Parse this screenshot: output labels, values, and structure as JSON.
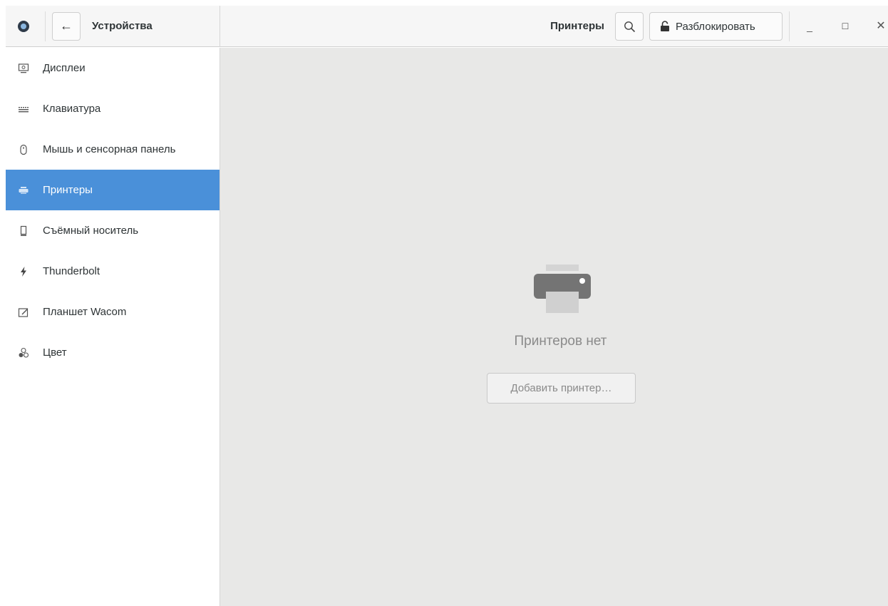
{
  "header": {
    "left_title": "Устройства",
    "right_title": "Принтеры",
    "unlock_label": "Разблокировать"
  },
  "sidebar": {
    "items": [
      {
        "label": "Дисплеи",
        "icon": "display-icon",
        "selected": false
      },
      {
        "label": "Клавиатура",
        "icon": "keyboard-icon",
        "selected": false
      },
      {
        "label": "Мышь и сенсорная панель",
        "icon": "mouse-icon",
        "selected": false
      },
      {
        "label": "Принтеры",
        "icon": "printer-icon",
        "selected": true
      },
      {
        "label": "Съёмный носитель",
        "icon": "removable-media-icon",
        "selected": false
      },
      {
        "label": "Thunderbolt",
        "icon": "thunderbolt-icon",
        "selected": false
      },
      {
        "label": "Планшет Wacom",
        "icon": "tablet-icon",
        "selected": false
      },
      {
        "label": "Цвет",
        "icon": "color-icon",
        "selected": false
      }
    ]
  },
  "main": {
    "empty_message": "Принтеров нет",
    "add_button": "Добавить принтер…"
  },
  "colors": {
    "accent": "#4a90d9",
    "content_bg": "#e8e8e7",
    "header_bg": "#f6f6f6"
  }
}
